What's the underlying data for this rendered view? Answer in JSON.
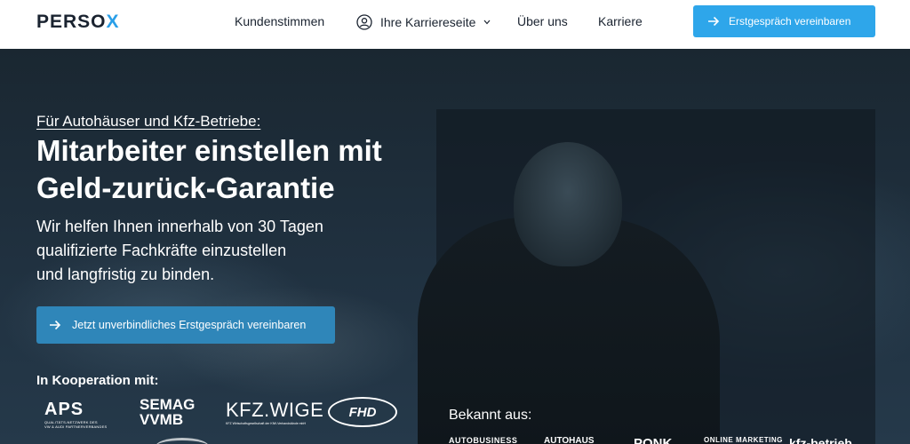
{
  "header": {
    "logo_main": "PERSO",
    "logo_x": "X",
    "nav": {
      "kundenstimmen": "Kundenstimmen",
      "karriereseite": "Ihre Karriereseite",
      "ueber_uns": "Über uns",
      "karriere": "Karriere"
    },
    "cta_label": "Erstgespräch vereinbaren"
  },
  "hero": {
    "eyebrow": "Für Autohäuser und Kfz-Betriebe:",
    "headline_line1": "Mitarbeiter einstellen mit",
    "headline_line2": "Geld-zurück-Garantie",
    "sub_line1": "Wir helfen Ihnen innerhalb von 30 Tagen",
    "sub_line2": "qualifizierte Fachkräfte einzustellen",
    "sub_line3": "und langfristig zu binden.",
    "cta_label": "Jetzt unverbindliches Erstgespräch vereinbaren"
  },
  "cooperation": {
    "label": "In Kooperation mit:",
    "logos": {
      "aps": "APS",
      "aps_sub1": "QUALITÄTS-NETZWERK DES",
      "aps_sub2": "VW & AUDI PARTNERVERBANDES",
      "semag1": "SEMAG",
      "semag2": "VVMB",
      "kfz": "KFZ.WIGE",
      "kfz_sub": "KFZ Wirtschaftsgesellschaft der KfW-Verbandstände mbH",
      "fhd": "FHD"
    }
  },
  "press": {
    "label": "Bekannt aus:",
    "items": [
      "AUTOBUSINESS",
      "AUTOHAUS",
      "PONK",
      "ONLINE MARKETING",
      "kfz-betrieb"
    ]
  },
  "colors": {
    "accent": "#2ea6ea",
    "hero_cta": "#2f86b9",
    "text_dark": "#1a2330"
  },
  "icons": {
    "nav_karriereseite": "person-circle-icon",
    "cta_arrow": "arrow-right-icon",
    "dropdown": "chevron-down-icon"
  }
}
